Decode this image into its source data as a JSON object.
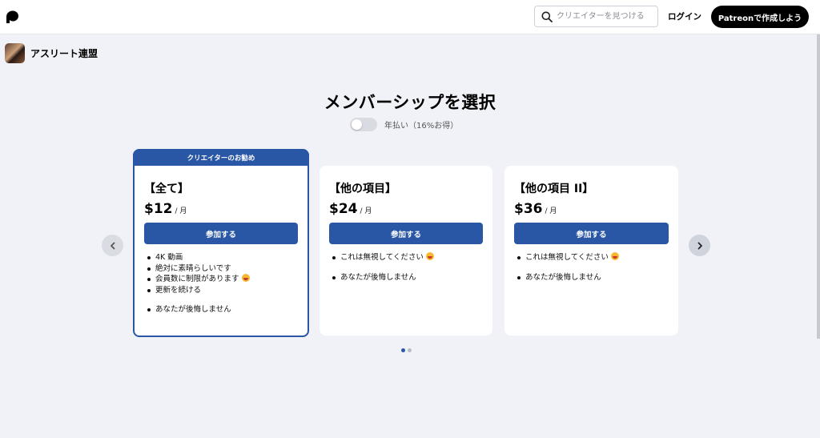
{
  "header": {
    "search": {
      "placeholder": "クリエイターを見つける"
    },
    "login_label": "ログイン",
    "create_label": "Patreonで作成しよう"
  },
  "creator": {
    "name": "アスリート連盟"
  },
  "main": {
    "title": "メンバーシップを選択",
    "billing_toggle": {
      "label": "年払い（16%お得）",
      "on": false
    }
  },
  "tiers": [
    {
      "ribbon": "クリエイターのお勧め",
      "title": "【全て】",
      "price": "$12",
      "period": "/ 月",
      "join_label": "参加する",
      "benefits": [
        "4K 動画",
        "絶対に素晴らしいです",
        "会員数に制限があります",
        "更新を続ける",
        "あなたが後悔しません"
      ]
    },
    {
      "title": "【他の項目】",
      "price": "$24",
      "period": "/ 月",
      "join_label": "参加する",
      "benefits": [
        "これは無視してください",
        "あなたが後悔しません"
      ]
    },
    {
      "title": "【他の項目 II】",
      "price": "$36",
      "period": "/ 月",
      "join_label": "参加する",
      "benefits": [
        "これは無視してください",
        "あなたが後悔しません"
      ]
    }
  ],
  "carousel": {
    "pages": 2,
    "current_page": 1
  },
  "colors": {
    "accent": "#2a57a5",
    "background": "#f1f2f7",
    "black_button": "#000000"
  },
  "icons": [
    "patreon-logo-icon",
    "search-icon",
    "chevron-left-icon",
    "chevron-right-icon",
    "grinning-emoji-icon"
  ]
}
